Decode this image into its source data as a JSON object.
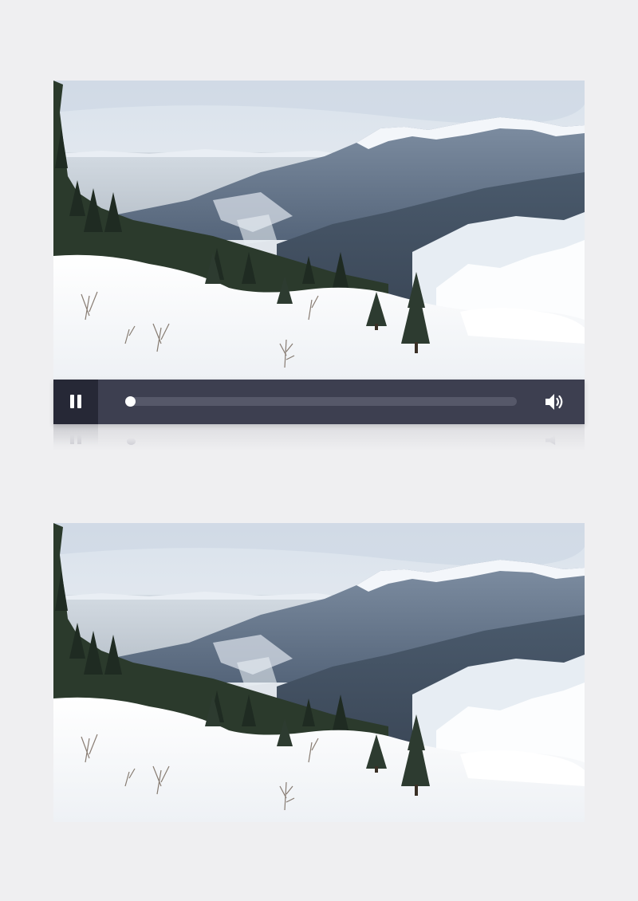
{
  "player": {
    "state": "paused",
    "progress": 0.0,
    "controls": {
      "play_pause_icon": "pause-icon",
      "volume_icon": "volume-icon"
    },
    "colors": {
      "control_bar": "#3d3f50",
      "play_button_bg": "#262836",
      "track": "#565869",
      "thumb": "#ffffff"
    }
  },
  "frames": [
    {
      "name": "video-frame-playing",
      "scene": "snowy-mountain-landscape"
    },
    {
      "name": "video-frame-preview",
      "scene": "snowy-mountain-landscape"
    }
  ]
}
